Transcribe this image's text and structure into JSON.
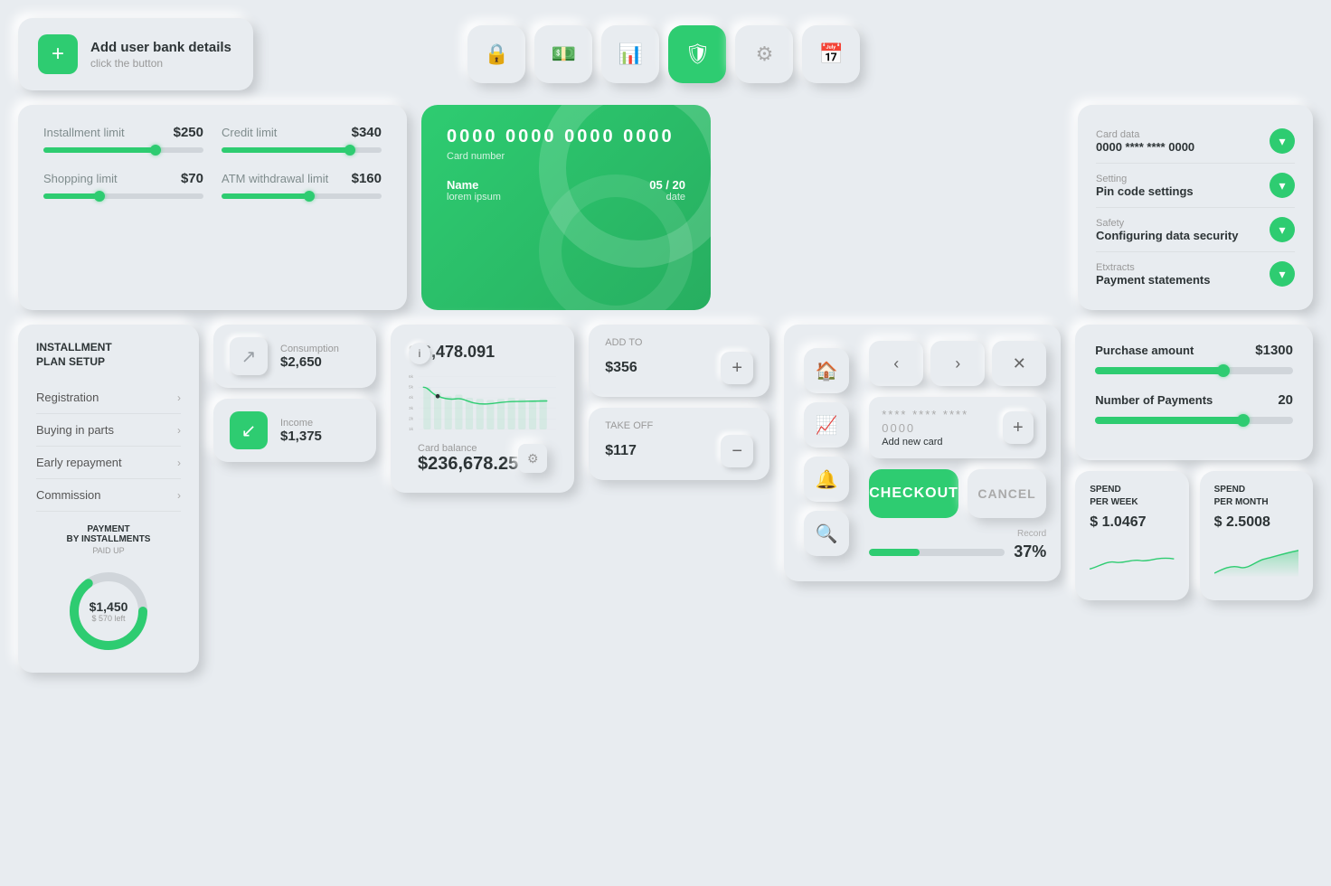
{
  "addUser": {
    "title": "Add user bank details",
    "subtitle": "click the button"
  },
  "topIcons": [
    "🔒",
    "$",
    "📊",
    "🛡",
    "⚙",
    "📅"
  ],
  "limits": [
    {
      "label": "Installment limit",
      "value": "$250",
      "pct": 70
    },
    {
      "label": "Credit limit",
      "value": "$340",
      "pct": 80
    },
    {
      "label": "Shopping limit",
      "value": "$70",
      "pct": 35
    },
    {
      "label": "ATM withdrawal limit",
      "value": "$160",
      "pct": 55
    }
  ],
  "creditCard": {
    "number": "0000 0000 0000 0000",
    "numberLabel": "Card number",
    "name": "Name",
    "nameVal": "lorem ipsum",
    "date": "05 / 20",
    "dateVal": "date"
  },
  "cardSettings": [
    {
      "category": "Card data",
      "name": "0000 **** **** 0000"
    },
    {
      "category": "Setting",
      "name": "Pin code settings"
    },
    {
      "category": "Safety",
      "name": "Configuring data security"
    },
    {
      "category": "Etxtracts",
      "name": "Payment statements"
    }
  ],
  "installmentPlan": {
    "title": "INSTALLMENT\nPLAN SETUP",
    "items": [
      "Registration",
      "Buying in parts",
      "Early repayment",
      "Commission"
    ],
    "paymentTitle": "PAYMENT\nBY INSTALLMENTS",
    "paymentSub": "PAID UP",
    "amount": "$1,450",
    "left": "$ 570 left"
  },
  "stats": [
    {
      "label": "Consumption",
      "value": "$2,650",
      "type": "gray"
    },
    {
      "label": "Income",
      "value": "$1,375",
      "type": "green"
    }
  ],
  "chart": {
    "title": "$ 6,478.091",
    "yLabels": [
      "6k",
      "5k",
      "4k",
      "3k",
      "2k",
      "1k"
    ],
    "balanceLabel": "Card balance",
    "balanceValue": "$236,678.25"
  },
  "transactions": [
    {
      "label": "ADD TO",
      "amount": "$356",
      "btnIcon": "+"
    },
    {
      "label": "TAKE OFF",
      "amount": "$117",
      "btnIcon": "−"
    }
  ],
  "navIcons": [
    "🏠",
    "📈",
    "🔔",
    "🔍"
  ],
  "keypad": {
    "rows": [
      [
        "←",
        "→",
        "✕"
      ],
      [
        "**** **** **** 0000",
        "+"
      ]
    ],
    "cardText": "**** **** **** 0000",
    "addText": "Add new card"
  },
  "checkout": {
    "btnLabel": "CHECKOUT",
    "cancelLabel": "CANCEL"
  },
  "record": {
    "label": "Record",
    "pct": "37%",
    "fill": 37
  },
  "purchase": {
    "amountLabel": "Purchase amount",
    "amountValue": "$1300",
    "barFill": 65,
    "paymentsLabel": "Number of Payments",
    "paymentsValue": "20",
    "paymentsBarFill": 75
  },
  "spend": [
    {
      "period": "SPEND\nPER WEEK",
      "amount": "$ 1.0467"
    },
    {
      "period": "SPEND\nPER MONTH",
      "amount": "$ 2.5008"
    }
  ]
}
